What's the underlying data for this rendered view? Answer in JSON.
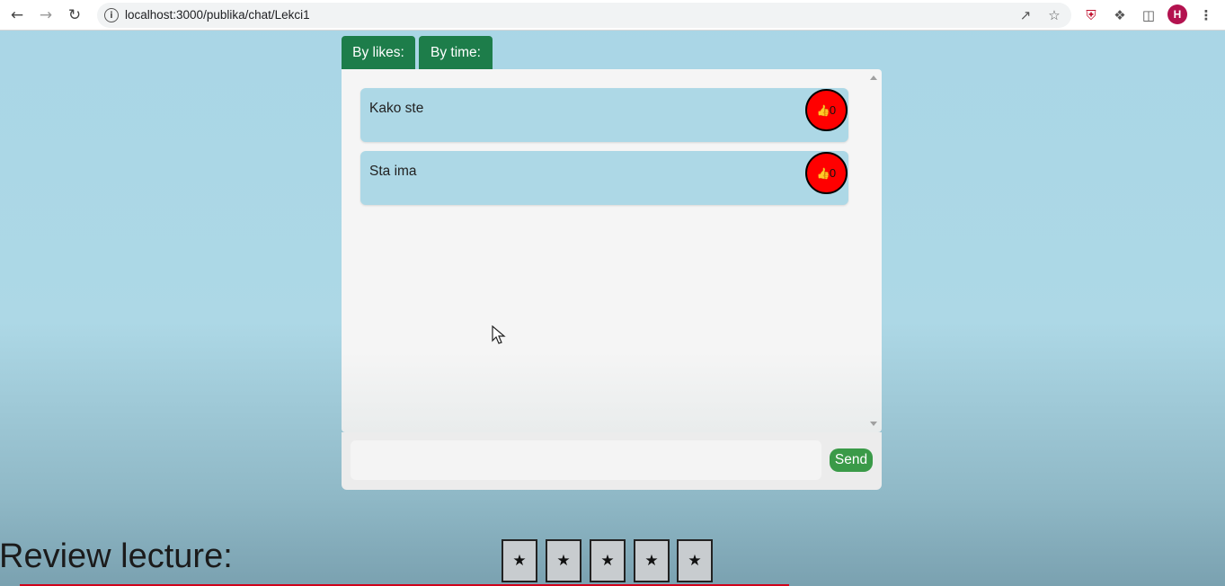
{
  "browser": {
    "url": "localhost:3000/publika/chat/Lekci1",
    "avatar_letter": "H",
    "icons": {
      "back": "back-arrow-icon",
      "forward": "forward-arrow-icon",
      "reload": "reload-icon",
      "info": "info-icon",
      "share": "share-icon",
      "bookmark": "star-bookmark-icon",
      "extension_ublock": "shield-extension-icon",
      "extensions": "puzzle-extensions-icon",
      "side_panel": "side-panel-icon",
      "menu": "kebab-menu-icon"
    }
  },
  "sort": {
    "by_likes_label": "By likes:",
    "by_time_label": "By time:"
  },
  "messages": [
    {
      "text": "Kako ste",
      "likes": "0"
    },
    {
      "text": "Sta ima",
      "likes": "0"
    }
  ],
  "composer": {
    "value": "",
    "send_label": "Send"
  },
  "review": {
    "title": "Review lecture:",
    "star_glyph": "★",
    "stars_count": 5
  },
  "colors": {
    "accent_green": "#1d7d4a",
    "send_green": "#3a9a48",
    "message_bg": "#add8e6",
    "like_red": "#ff0000",
    "avatar": "#b3124f"
  }
}
